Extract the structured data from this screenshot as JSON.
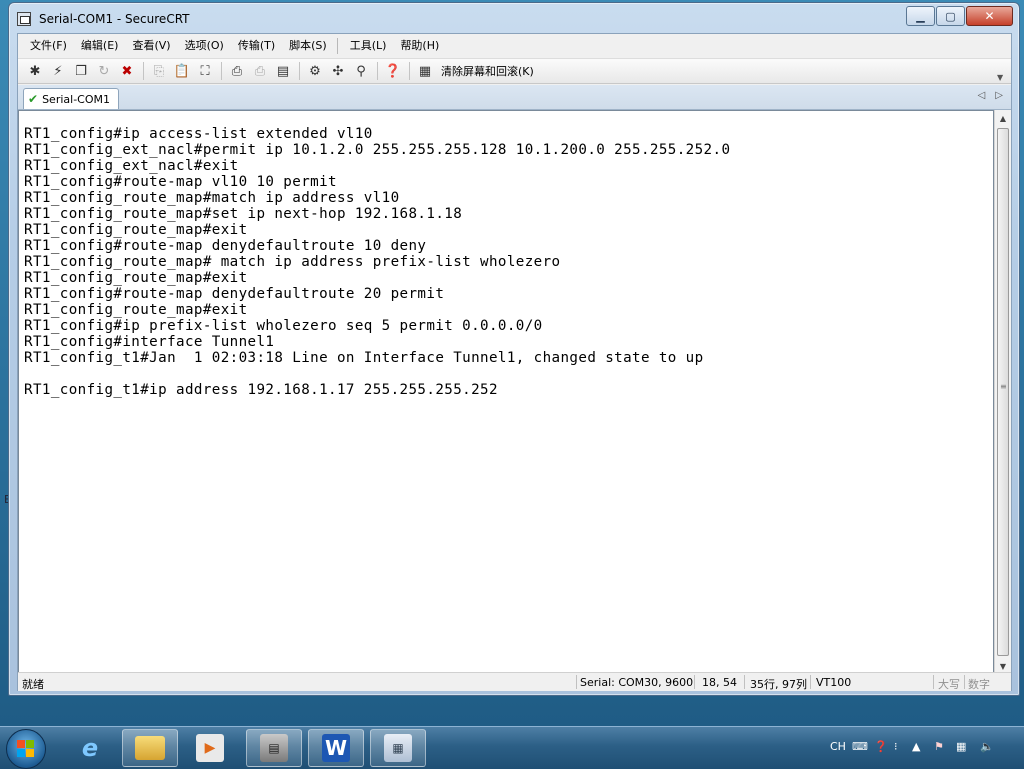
{
  "window": {
    "title": "Serial-COM1 - SecureCRT",
    "minimize": "▁",
    "maximize": "▢",
    "close": "✕"
  },
  "menu": [
    {
      "label": "文件(F)"
    },
    {
      "label": "编辑(E)"
    },
    {
      "label": "查看(V)"
    },
    {
      "label": "选项(O)"
    },
    {
      "label": "传输(T)"
    },
    {
      "label": "脚本(S)"
    },
    {
      "label": "工具(L)"
    },
    {
      "label": "帮助(H)"
    }
  ],
  "toolbar": {
    "icons": [
      "connect-icon",
      "quick-connect-icon",
      "connect-tab-icon",
      "reconnect-icon",
      "disconnect-icon",
      "copy-icon",
      "paste-icon",
      "find-icon",
      "print-icon",
      "print-setup-icon",
      "print-screen-icon",
      "session-options-icon",
      "global-options-icon",
      "keymap-icon",
      "help-icon",
      "clear-screen-icon"
    ],
    "clear_label": "清除屏幕和回滚(K)"
  },
  "tabs": [
    {
      "label": "Serial-COM1",
      "active": true,
      "status": "connected"
    }
  ],
  "terminal": {
    "lines": [
      "RT1_config#ip access-list extended vl10",
      "RT1_config_ext_nacl#permit ip 10.1.2.0 255.255.255.128 10.1.200.0 255.255.252.0",
      "RT1_config_ext_nacl#exit",
      "RT1_config#route-map vl10 10 permit",
      "RT1_config_route_map#match ip address vl10",
      "RT1_config_route_map#set ip next-hop 192.168.1.18",
      "RT1_config_route_map#exit",
      "RT1_config#route-map denydefaultroute 10 deny",
      "RT1_config_route_map# match ip address prefix-list wholezero",
      "RT1_config_route_map#exit",
      "RT1_config#route-map denydefaultroute 20 permit",
      "RT1_config_route_map#exit",
      "RT1_config#ip prefix-list wholezero seq 5 permit 0.0.0.0/0",
      "RT1_config#interface Tunnel1",
      "RT1_config_t1#Jan  1 02:03:18 Line on Interface Tunnel1, changed state to up",
      "",
      "RT1_config_t1#ip address 192.168.1.17 255.255.255.252"
    ]
  },
  "statusbar": {
    "ready": "就绪",
    "connection": "Serial: COM30, 9600",
    "cursor": "18,  54",
    "size": "35行, 97列",
    "emulation": "VT100",
    "caps": "大写",
    "num": "数字"
  },
  "taskbar": {
    "apps": [
      "ie-icon",
      "explorer-icon",
      "media-player-icon",
      "securecrt-icon",
      "word-icon",
      "notepad-icon"
    ],
    "tray_lang": "CH"
  },
  "colors": {
    "terminal_bg": "#ffffff",
    "terminal_fg": "#000000",
    "tab_check": "#2a9a2a"
  }
}
